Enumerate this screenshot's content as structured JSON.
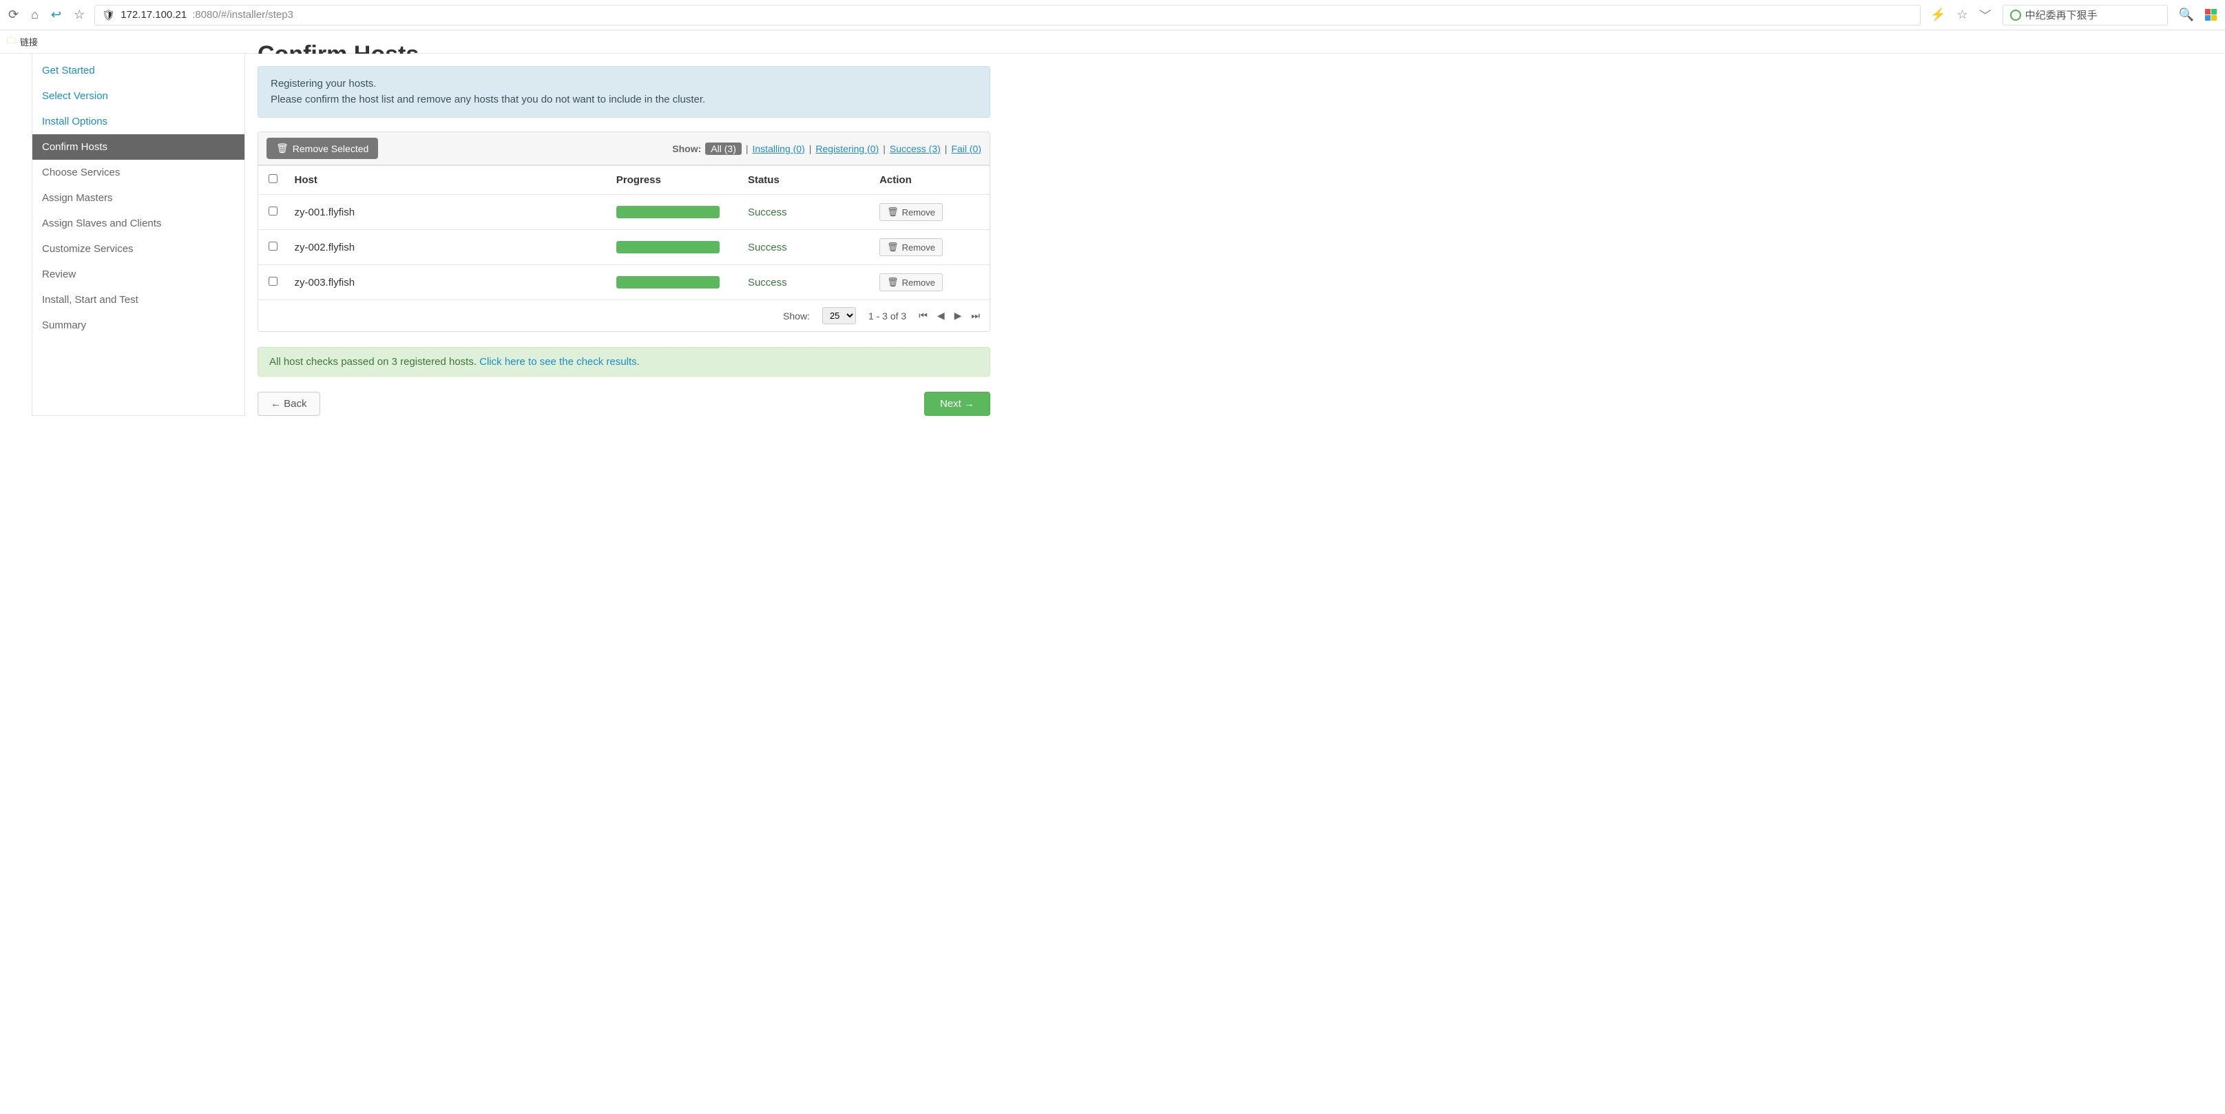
{
  "browser": {
    "url_host": "172.17.100.21",
    "url_path": ":8080/#/installer/step3",
    "search_text": "中纪委再下狠手",
    "bookmark_label": "链接"
  },
  "sidebar": {
    "items": [
      {
        "label": "Get Started",
        "state": "link"
      },
      {
        "label": "Select Version",
        "state": "link"
      },
      {
        "label": "Install Options",
        "state": "link"
      },
      {
        "label": "Confirm Hosts",
        "state": "active"
      },
      {
        "label": "Choose Services",
        "state": "disabled"
      },
      {
        "label": "Assign Masters",
        "state": "disabled"
      },
      {
        "label": "Assign Slaves and Clients",
        "state": "disabled"
      },
      {
        "label": "Customize Services",
        "state": "disabled"
      },
      {
        "label": "Review",
        "state": "disabled"
      },
      {
        "label": "Install, Start and Test",
        "state": "disabled"
      },
      {
        "label": "Summary",
        "state": "disabled"
      }
    ]
  },
  "page": {
    "title": "Confirm Hosts",
    "banner_line1": "Registering your hosts.",
    "banner_line2": "Please confirm the host list and remove any hosts that you do not want to include in the cluster."
  },
  "toolbar": {
    "remove_selected": "Remove Selected",
    "show_label": "Show:",
    "filters": {
      "all": "All (3)",
      "installing": "Installing (0)",
      "registering": "Registering (0)",
      "success": "Success (3)",
      "fail": "Fail (0)"
    }
  },
  "table": {
    "headers": {
      "host": "Host",
      "progress": "Progress",
      "status": "Status",
      "action": "Action"
    },
    "rows": [
      {
        "host": "zy-001.flyfish",
        "status": "Success",
        "action": "Remove"
      },
      {
        "host": "zy-002.flyfish",
        "status": "Success",
        "action": "Remove"
      },
      {
        "host": "zy-003.flyfish",
        "status": "Success",
        "action": "Remove"
      }
    ],
    "footer": {
      "show_label": "Show:",
      "page_size": "25",
      "range": "1 - 3 of 3"
    }
  },
  "alert": {
    "text": "All host checks passed on 3 registered hosts. ",
    "link": "Click here to see the check results",
    "suffix": "."
  },
  "buttons": {
    "back": "← Back",
    "next": "Next →"
  }
}
